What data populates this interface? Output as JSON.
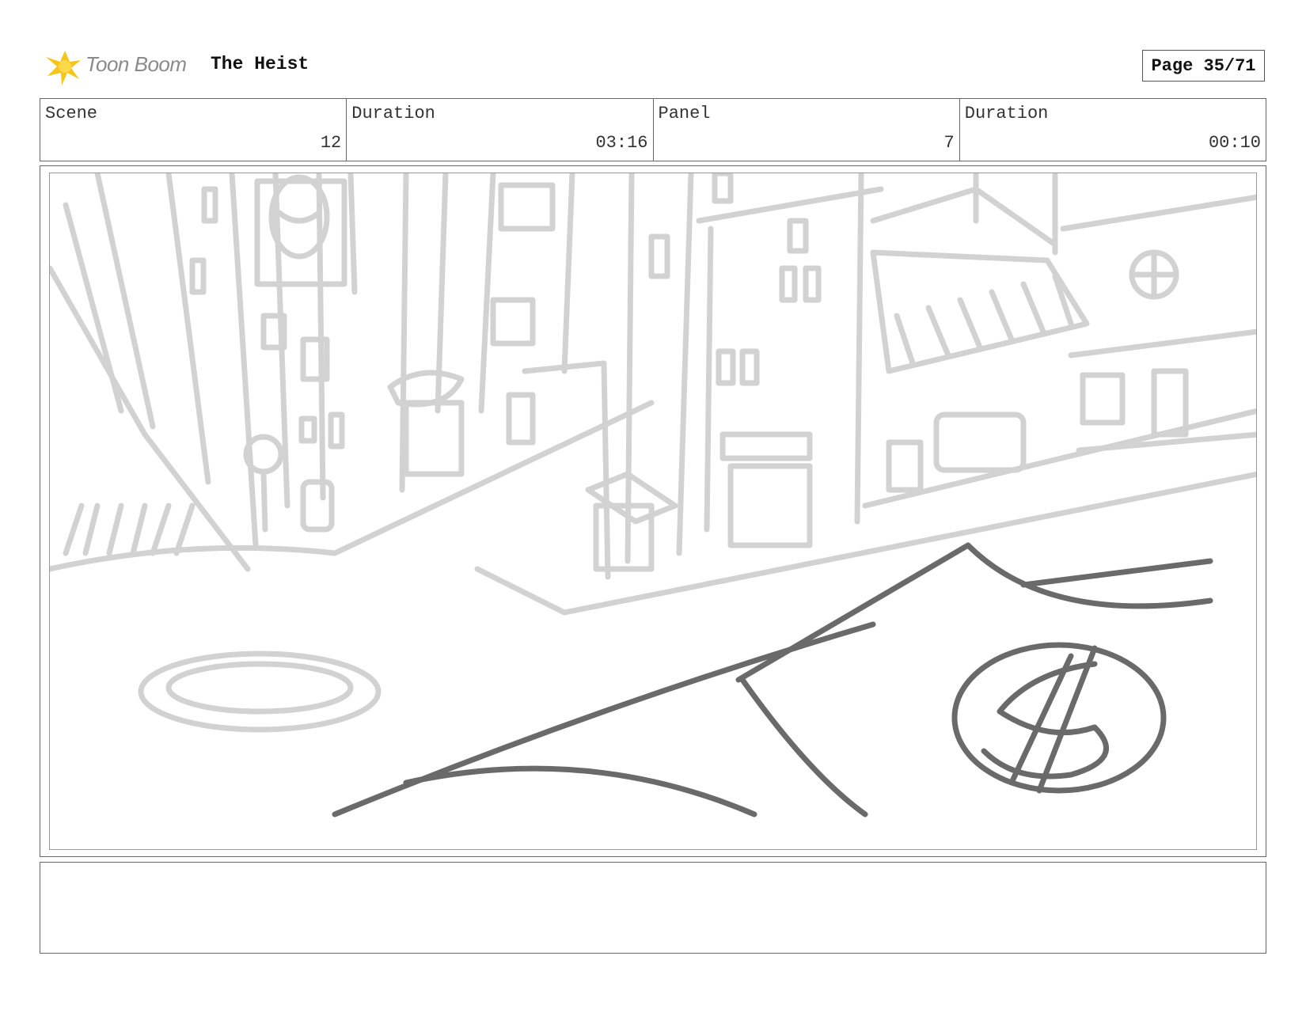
{
  "header": {
    "logo_text": "Toon Boom",
    "project_title": "The Heist",
    "page_label": "Page 35/71"
  },
  "info": {
    "scene_label": "Scene",
    "scene_value": "12",
    "scene_duration_label": "Duration",
    "scene_duration_value": "03:16",
    "panel_label": "Panel",
    "panel_value": "7",
    "panel_duration_label": "Duration",
    "panel_duration_value": "00:10"
  },
  "panel": {
    "sketch_description": "",
    "money_symbol": "$"
  },
  "notes": {
    "text": ""
  },
  "colors": {
    "logo_yellow": "#f5c518",
    "sketch_light": "#cfcfcf",
    "sketch_dark": "#6a6a6a"
  }
}
